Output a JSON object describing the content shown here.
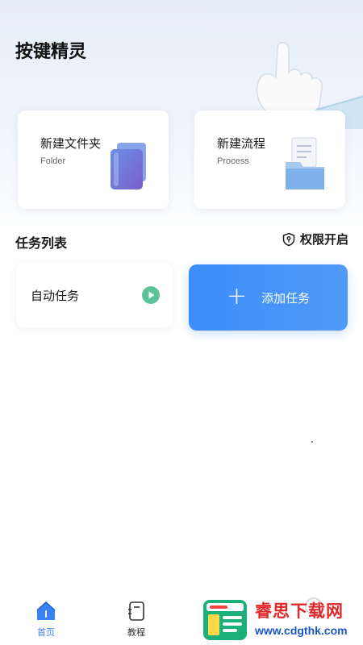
{
  "app": {
    "title": "按键精灵"
  },
  "cards": [
    {
      "title": "新建文件夹",
      "subtitle": "Folder",
      "icon": "folder-icon"
    },
    {
      "title": "新建流程",
      "subtitle": "Process",
      "icon": "document-folder-icon"
    }
  ],
  "tasks": {
    "section_title": "任务列表",
    "permission_label": "权限开启",
    "auto_task_label": "自动任务",
    "add_task_label": "添加任务"
  },
  "nav": {
    "items": [
      {
        "label": "首页",
        "icon": "home-icon",
        "active": true
      },
      {
        "label": "教程",
        "icon": "tutorial-icon",
        "active": false
      }
    ]
  },
  "watermark": {
    "name": "睿思下载网",
    "url": "www.cdgthk.com"
  },
  "colors": {
    "accent": "#3d8dfa",
    "play": "#5cc49a",
    "watermark_red": "#e0282a",
    "watermark_blue": "#1a56c8"
  }
}
